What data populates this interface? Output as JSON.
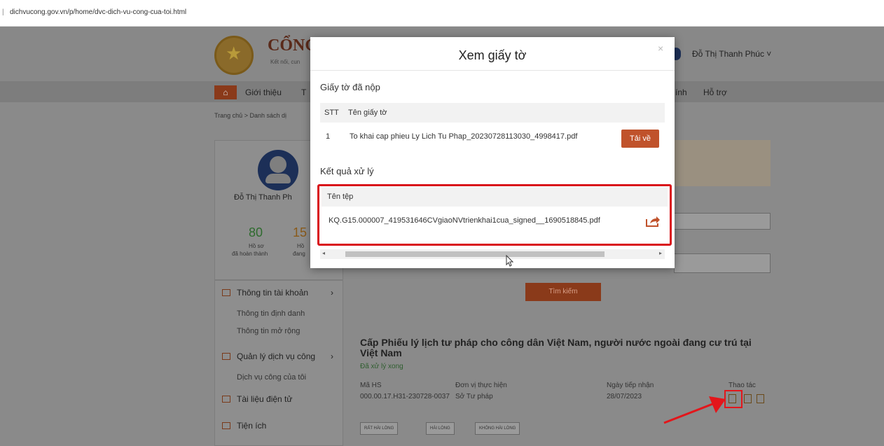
{
  "browser": {
    "url": "dichvucong.gov.vn/p/home/dvc-dich-vu-cong-cua-toi.html"
  },
  "header": {
    "logo_title": "CỔNG",
    "logo_subtitle": "Kết nối, cun",
    "user_name": "Đỗ Thị Thanh Phúc ˅"
  },
  "nav": {
    "items": [
      "Giới thiệu",
      "T",
      "ính",
      "Hỗ trợ"
    ]
  },
  "breadcrumb": "Trang chủ  >  Danh sách dị",
  "profile": {
    "name": "Đỗ Thị Thanh Ph",
    "stat1_value": "80",
    "stat1_label_line1": "Hồ sơ",
    "stat1_label_line2": "đã hoàn thành",
    "stat2_value": "15",
    "stat2_label_line1": "Hồ",
    "stat2_label_line2": "đang"
  },
  "sidebar": {
    "account": "Thông tin tài khoản",
    "account_sub1": "Thông tin định danh",
    "account_sub2": "Thông tin mở rộng",
    "services": "Quản lý dịch vụ công",
    "services_sub1": "Dịch vụ công của tôi",
    "documents": "Tài liệu điện tử",
    "utilities": "Tiện ích"
  },
  "search": {
    "button_label": "Tìm kiếm"
  },
  "record": {
    "title": "Cấp Phiếu lý lịch tư pháp cho công dân Việt Nam, người nước ngoài đang cư trú tại Việt Nam",
    "status": "Đã xử lý xong",
    "col_code": "Mã HS",
    "col_unit": "Đơn vị thực hiện",
    "col_date": "Ngày tiếp nhận",
    "col_actions": "Thao tác",
    "code_value": "000.00.17.H31-230728-0037",
    "unit_value": "Sở Tư pháp",
    "date_value": "28/07/2023",
    "rating": [
      "RẤT HÀI LÒNG",
      "HÀI LÒNG",
      "KHÔNG HÀI LÒNG"
    ]
  },
  "modal": {
    "title": "Xem giấy tờ",
    "close": "×",
    "submitted_title": "Giấy tờ đã nộp",
    "submitted_cols": [
      "STT",
      "Tên giấy tờ"
    ],
    "submitted_rows": [
      {
        "stt": "1",
        "name": "To khai cap phieu Ly Lich Tu Phap_20230728113030_4998417.pdf",
        "action": "Tải về"
      }
    ],
    "result_title": "Kết quả xử lý",
    "result_col": "Tên tệp",
    "result_file": "KQ.G15.000007_419531646CVgiaoNVtrienkhai1cua_signed__1690518845.pdf"
  },
  "colors": {
    "accent": "#c0522b",
    "highlight": "#d9121a"
  }
}
